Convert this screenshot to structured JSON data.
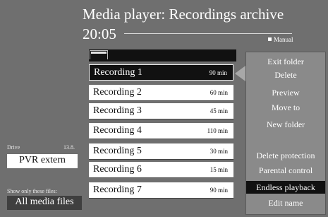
{
  "header": {
    "title": "Media player: Recordings archive",
    "time": "20:05",
    "mode": "Manual"
  },
  "left_panel": {
    "drive_label": "Drive",
    "drive_suffix": "13.8.",
    "drive_value": "PVR extern",
    "filter_label": "Show only these files:",
    "filter_value": "All media files"
  },
  "recordings": [
    {
      "name": "Recording 1",
      "duration": "90 min",
      "selected": true
    },
    {
      "name": "Recording 2",
      "duration": "60 min"
    },
    {
      "name": "Recording 3",
      "duration": "45 min"
    },
    {
      "name": "Recording 4",
      "duration": "110 min"
    },
    {
      "name": "Recording 5",
      "duration": "30 min"
    },
    {
      "name": "Recording 6",
      "duration": "15 min"
    },
    {
      "name": "Recording 7",
      "duration": "90 min"
    }
  ],
  "options_menu": {
    "items": [
      {
        "label": "Exit folder"
      },
      {
        "label": "Delete"
      },
      {
        "label": "Preview"
      },
      {
        "label": "Move to"
      },
      {
        "label": "New folder"
      },
      {
        "label": "Delete protection"
      },
      {
        "label": "Parental control"
      },
      {
        "label": "Endless playback",
        "active": true
      },
      {
        "label": "Edit name"
      }
    ]
  }
}
